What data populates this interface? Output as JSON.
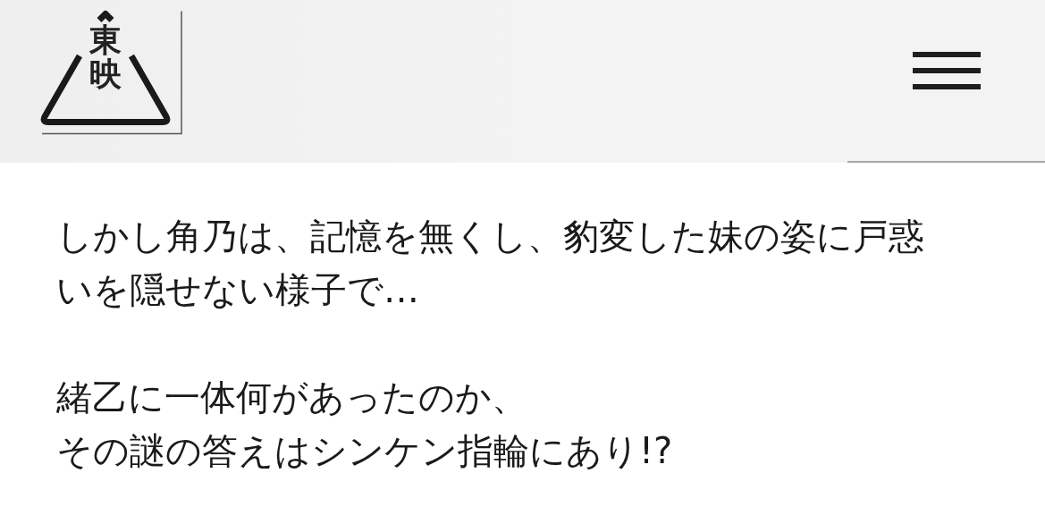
{
  "header": {
    "logo_text": "東映"
  },
  "paragraphs": [
    [
      "しかし角乃は、記憶を無くし、豹変した妹の姿に戸惑いを隠せない様子で…"
    ],
    [
      "緒乙に一体何があったのか、",
      "その謎の答えはシンケン指輪にあり!?"
    ]
  ]
}
